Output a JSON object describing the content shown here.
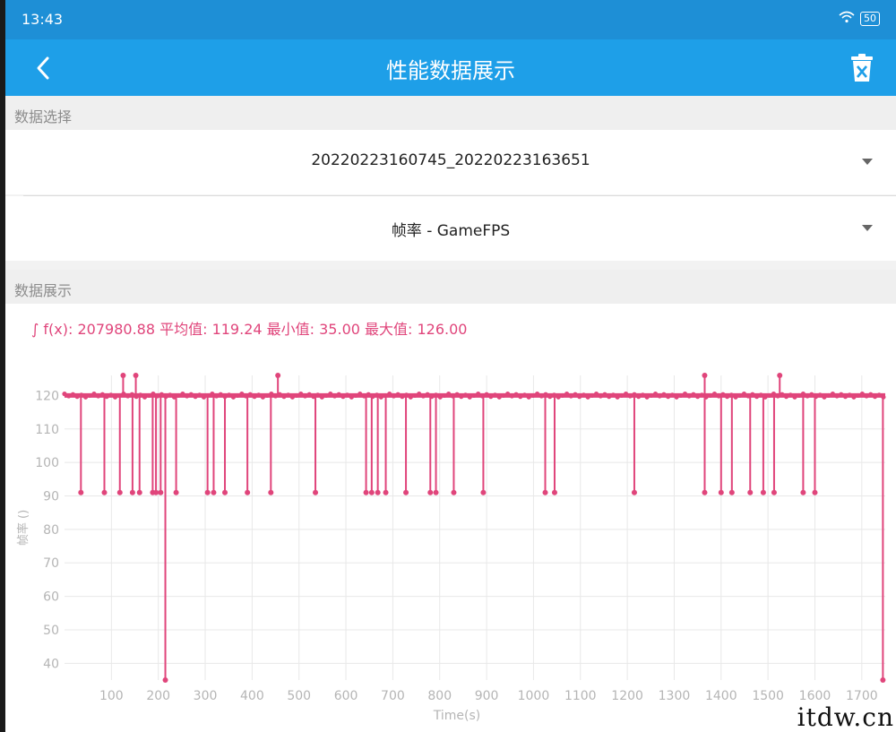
{
  "status": {
    "time": "13:43",
    "battery": "50"
  },
  "header": {
    "title": "性能数据展示"
  },
  "sections": {
    "select_title": "数据选择",
    "display_title": "数据展示"
  },
  "selectors": {
    "session": "20220223160745_20220223163651",
    "metric": "帧率 - GameFPS"
  },
  "stats": {
    "text": "∫ f(x): 207980.88 平均值: 119.24 最小值: 35.00 最大值: 126.00"
  },
  "watermark": "itdw.cn",
  "colors": {
    "accent": "#1e9fe8",
    "status": "#1e8fd6",
    "series": "#e0457b"
  },
  "chart_data": {
    "type": "line",
    "xlabel": "Time(s)",
    "ylabel": "帧率 ()",
    "xlim": [
      0,
      1750
    ],
    "ylim": [
      35,
      126
    ],
    "x_ticks": [
      100,
      200,
      300,
      400,
      500,
      600,
      700,
      800,
      900,
      1000,
      1100,
      1200,
      1300,
      1400,
      1500,
      1600,
      1700
    ],
    "y_ticks": [
      40,
      50,
      60,
      70,
      80,
      90,
      100,
      110,
      120
    ],
    "series": [
      {
        "name": "",
        "baseline": 120,
        "dips": [
          {
            "x": 35,
            "y": 91
          },
          {
            "x": 85,
            "y": 91
          },
          {
            "x": 118,
            "y": 91
          },
          {
            "x": 145,
            "y": 91
          },
          {
            "x": 160,
            "y": 91
          },
          {
            "x": 188,
            "y": 91
          },
          {
            "x": 195,
            "y": 91
          },
          {
            "x": 205,
            "y": 91
          },
          {
            "x": 215,
            "y": 35
          },
          {
            "x": 238,
            "y": 91
          },
          {
            "x": 305,
            "y": 91
          },
          {
            "x": 318,
            "y": 91
          },
          {
            "x": 342,
            "y": 91
          },
          {
            "x": 390,
            "y": 91
          },
          {
            "x": 440,
            "y": 91
          },
          {
            "x": 535,
            "y": 91
          },
          {
            "x": 643,
            "y": 91
          },
          {
            "x": 655,
            "y": 91
          },
          {
            "x": 668,
            "y": 91
          },
          {
            "x": 685,
            "y": 91
          },
          {
            "x": 728,
            "y": 91
          },
          {
            "x": 780,
            "y": 91
          },
          {
            "x": 792,
            "y": 91
          },
          {
            "x": 830,
            "y": 91
          },
          {
            "x": 893,
            "y": 91
          },
          {
            "x": 1025,
            "y": 91
          },
          {
            "x": 1045,
            "y": 91
          },
          {
            "x": 1215,
            "y": 91
          },
          {
            "x": 1365,
            "y": 91
          },
          {
            "x": 1400,
            "y": 91
          },
          {
            "x": 1423,
            "y": 91
          },
          {
            "x": 1462,
            "y": 91
          },
          {
            "x": 1490,
            "y": 91
          },
          {
            "x": 1513,
            "y": 91
          },
          {
            "x": 1575,
            "y": 91
          },
          {
            "x": 1600,
            "y": 91
          },
          {
            "x": 1745,
            "y": 35
          }
        ],
        "peaks": [
          {
            "x": 125,
            "y": 126
          },
          {
            "x": 152,
            "y": 126
          },
          {
            "x": 455,
            "y": 126
          },
          {
            "x": 1365,
            "y": 126
          },
          {
            "x": 1525,
            "y": 126
          }
        ],
        "end": {
          "x": 1750,
          "y": 120
        }
      }
    ]
  }
}
